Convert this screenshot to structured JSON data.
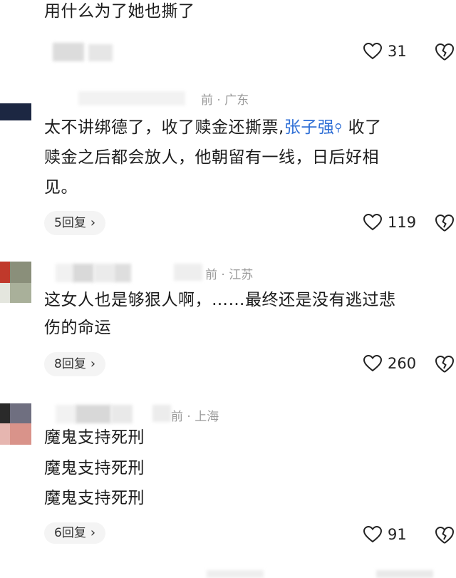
{
  "comments": [
    {
      "text": "用什么为了她也撕了",
      "likes": "31"
    },
    {
      "meta_time": "前",
      "meta_region": "广东",
      "text_a": "太不讲绑德了，收了赎金还撕票,",
      "mention": "张子强",
      "text_b": "收了",
      "line2": "赎金之后都会放人，他朝留有一线，日后好相",
      "line3": "见。",
      "replies": "5回复",
      "likes": "119"
    },
    {
      "meta_time": "前",
      "meta_region": "江苏",
      "line1": "这女人也是够狠人啊，……最终还是没有逃过悲",
      "line2": "伤的命运",
      "replies": "8回复",
      "likes": "260"
    },
    {
      "meta_time": "前",
      "meta_region": "上海",
      "line1": "魔鬼支持死刑",
      "line2": "魔鬼支持死刑",
      "line3": "魔鬼支持死刑",
      "replies": "6回复",
      "likes": "91"
    }
  ],
  "icons": {
    "like": "heart-outline-icon",
    "dislike": "broken-heart-icon",
    "search": "search-icon",
    "chevron": "chevron-right-icon"
  },
  "colors": {
    "mention": "#2f6fd6",
    "meta": "#9a9a9a"
  }
}
